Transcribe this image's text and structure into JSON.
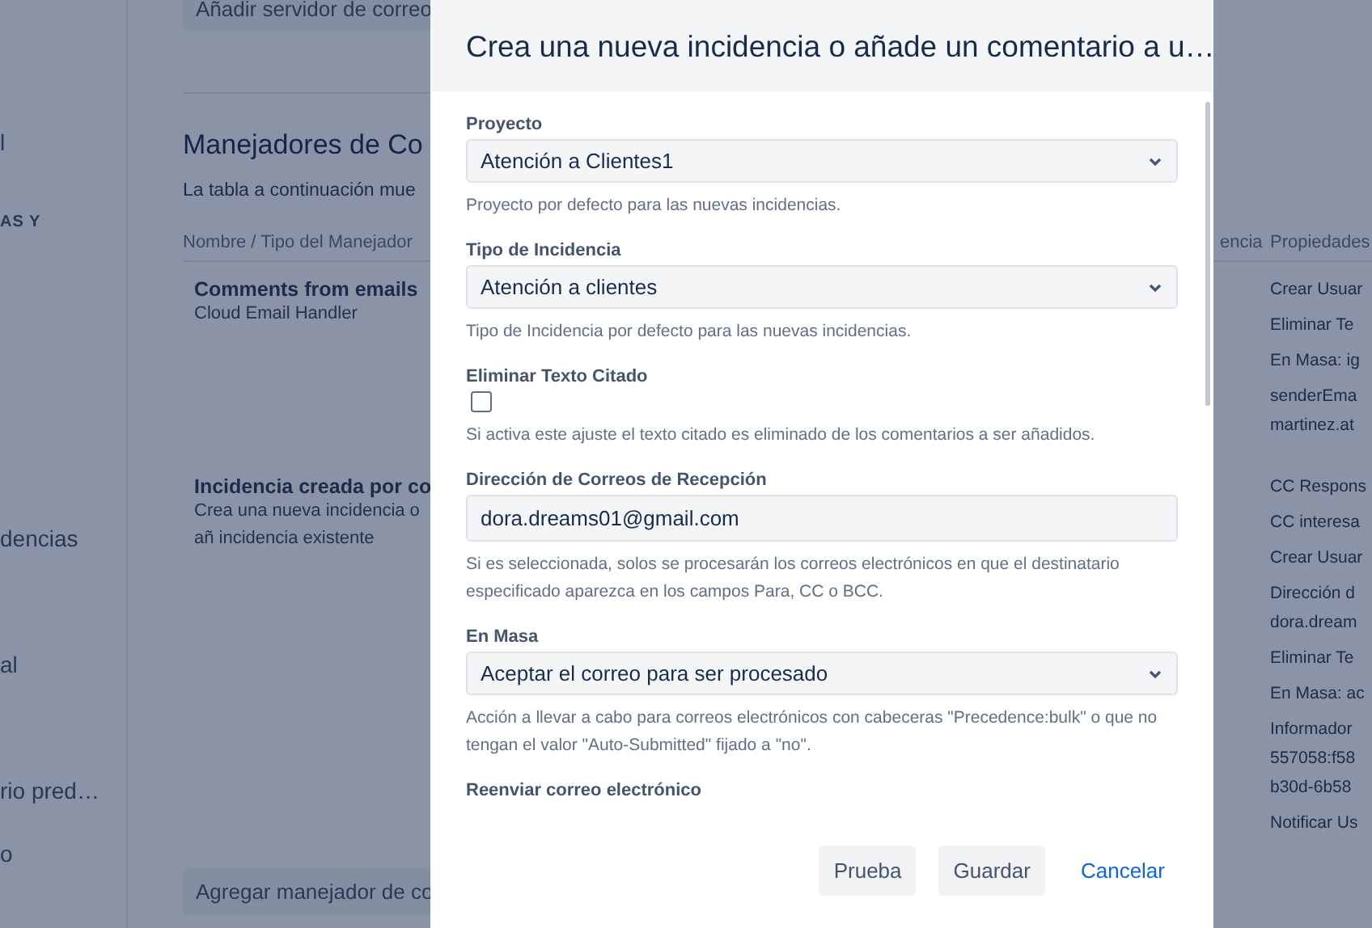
{
  "sidebar": {
    "items": [
      {
        "kind": "item",
        "label": "l"
      },
      {
        "kind": "heading",
        "label": "AS Y"
      },
      {
        "kind": "item",
        "label": "dencias"
      },
      {
        "kind": "item",
        "label": "al"
      },
      {
        "kind": "item",
        "label": "rio pred…"
      },
      {
        "kind": "item",
        "label": "o"
      }
    ]
  },
  "main": {
    "top_button": "Añadir servidor de correo",
    "heading": "Manejadores de Co",
    "description": "La tabla a continuación mue",
    "table": {
      "columns": [
        "Nombre / Tipo del Manejador",
        "encia",
        "Propiedades"
      ],
      "rows": [
        {
          "name": "Comments from emails",
          "type": "Cloud Email Handler",
          "properties": [
            [
              "Crear Usuar"
            ],
            [
              "Eliminar Te"
            ],
            [
              "En Masa: ig"
            ],
            [
              "senderEma",
              "martinez.at"
            ]
          ]
        },
        {
          "name": "Incidencia creada por co",
          "type": "Crea una nueva incidencia o añ incidencia existente",
          "properties": [
            [
              "CC Respons"
            ],
            [
              "CC interesa"
            ],
            [
              "Crear Usuar"
            ],
            [
              "Dirección d",
              "dora.dream"
            ],
            [
              "Eliminar Te"
            ],
            [
              "En Masa: ac"
            ],
            [
              "Informador",
              "557058:f58",
              "b30d-6b58"
            ],
            [
              "Notificar Us"
            ]
          ]
        }
      ]
    },
    "bottom_button": "Agregar manejador de co"
  },
  "dialog": {
    "title": "Crea una nueva incidencia o añade un comentario a u…",
    "fields": [
      {
        "kind": "select",
        "label": "Proyecto",
        "value": "Atención a Clientes1",
        "help": "Proyecto por defecto para las nuevas incidencias."
      },
      {
        "kind": "select",
        "label": "Tipo de Incidencia",
        "value": "Atención a clientes",
        "help": "Tipo de Incidencia por defecto para las nuevas incidencias."
      },
      {
        "kind": "checkbox",
        "label": "Eliminar Texto Citado",
        "checked": false,
        "help": "Si activa este ajuste el texto citado es eliminado de los comentarios a ser añadidos."
      },
      {
        "kind": "text",
        "label": "Dirección de Correos de Recepción",
        "value": "dora.dreams01@gmail.com",
        "help": "Si es seleccionada, solos se procesarán los correos electrónicos en que el destinatario especificado aparezca en los campos Para, CC o BCC."
      },
      {
        "kind": "select",
        "label": "En Masa",
        "value": "Aceptar el correo para ser procesado",
        "help": "Acción a llevar a cabo para correos electrónicos con cabeceras \"Precedence:bulk\" o que no tengan el valor \"Auto-Submitted\" fijado a \"no\"."
      },
      {
        "kind": "text",
        "label": "Reenviar correo electrónico"
      }
    ],
    "buttons": [
      {
        "kind": "default",
        "label": "Prueba"
      },
      {
        "kind": "default",
        "label": "Guardar"
      },
      {
        "kind": "link",
        "label": "Cancelar"
      }
    ]
  }
}
